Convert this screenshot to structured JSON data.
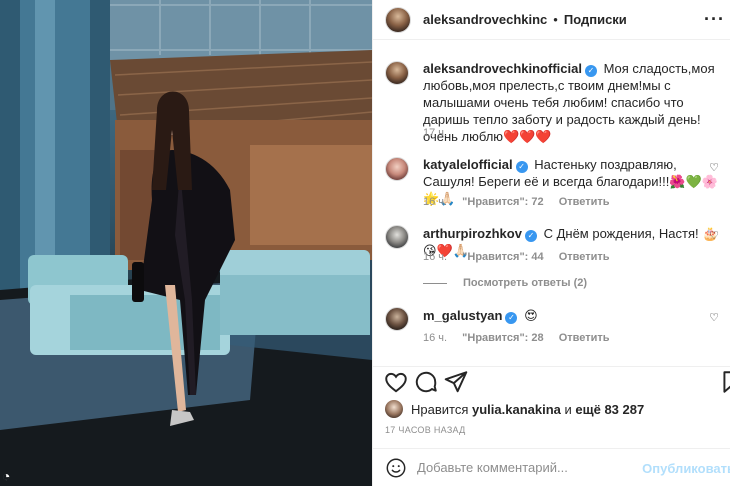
{
  "post": {
    "header": {
      "username": "aleksandrovechkinc",
      "separator": "•",
      "follow_label": "Подписки",
      "more_icon": "more-horizontal-icon"
    },
    "caption": {
      "username": "aleksandrovechkinofficial",
      "text": "Моя сладость,моя любовь,моя прелесть,с твоим днем!мы с малышами очень тебя любим! спасибо что даришь тепло заботу и радость каждый день! очень люблю❤️❤️❤️",
      "time": "17 ч."
    },
    "comments": [
      {
        "username": "katyalelofficial",
        "verified": true,
        "text": "Настеньку поздравляю, Сашуля! Береги её и всегда благодари!!!🌺💚🌸🌟🙏🏻",
        "time": "16 ч.",
        "likes": "\"Нравится\": 72",
        "reply": "Ответить"
      },
      {
        "username": "arthurpirozhkov",
        "verified": true,
        "text": "С Днём рождения, Настя! 🎂😘❤️🙏🏻",
        "time": "16 ч.",
        "likes": "\"Нравится\": 44",
        "reply": "Ответить",
        "view_replies": "Посмотреть ответы (2)"
      },
      {
        "username": "m_galustyan",
        "verified": true,
        "text": "😍",
        "time": "16 ч.",
        "likes": "\"Нравится\": 28",
        "reply": "Ответить"
      }
    ],
    "actions": {
      "like_icon": "heart-icon",
      "comment_icon": "comment-icon",
      "share_icon": "send-icon",
      "save_icon": "bookmark-icon"
    },
    "likes": {
      "prefix": "Нравится",
      "user": "yulia.kanakina",
      "middle": "и",
      "others": "ещё 83 287"
    },
    "time_ago": "17 ЧАСОВ НАЗАД",
    "add_comment": {
      "placeholder": "Добавьте комментарий...",
      "publish_label": "Опубликовать",
      "emoji_icon": "smiley-icon"
    }
  },
  "colors": {
    "link_blue": "#3897f0",
    "publish_disabled": "#b2dffc",
    "heart_red": "#ed4956",
    "muted": "#8e8e8e"
  }
}
